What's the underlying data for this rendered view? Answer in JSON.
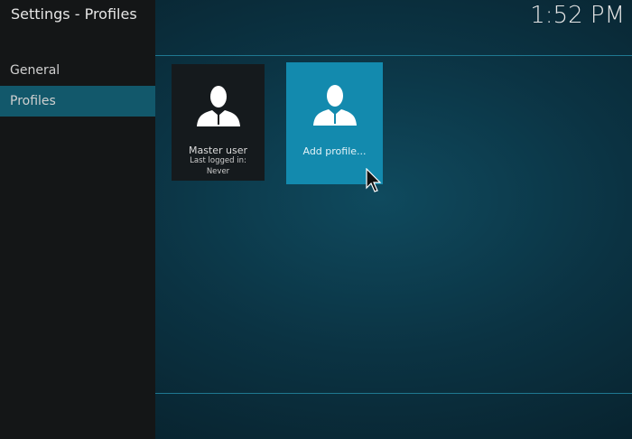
{
  "header": {
    "title": "Settings - Profiles",
    "clock": "1:52 PM"
  },
  "sidebar": {
    "items": [
      {
        "label": "General"
      },
      {
        "label": "Profiles"
      }
    ]
  },
  "profiles": [
    {
      "name": "Master user",
      "last_logged_label": "Last logged in:",
      "last_logged_value": "Never"
    },
    {
      "name": "Add profile..."
    }
  ],
  "colors": {
    "accent": "#138aae",
    "sidebar_active": "#12586b"
  }
}
